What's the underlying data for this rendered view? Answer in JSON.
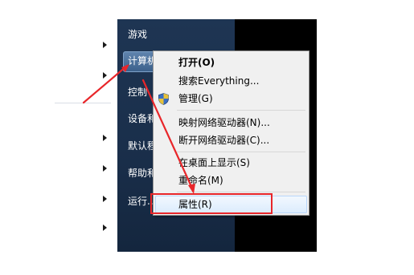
{
  "start_menu": {
    "right_items": [
      "游戏",
      "计算机",
      "控制",
      "设备和",
      "默认程",
      "帮助和",
      "运行..."
    ]
  },
  "context_menu": {
    "items": [
      {
        "label": "打开(O)",
        "bold": true
      },
      {
        "label": "搜索Everything..."
      },
      {
        "label": "管理(G)",
        "icon": "uac-shield-icon"
      },
      {
        "label": "映射网络驱动器(N)..."
      },
      {
        "label": "断开网络驱动器(C)..."
      },
      {
        "label": "在桌面上显示(S)"
      },
      {
        "label": "重命名(M)"
      },
      {
        "label": "属性(R)",
        "highlighted": true
      }
    ]
  },
  "annotations": {
    "arrow_color": "#e8262a",
    "box_color": "#e8262a"
  }
}
